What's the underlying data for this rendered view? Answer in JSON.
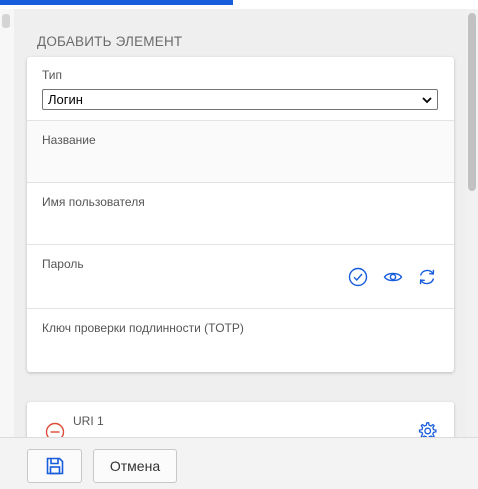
{
  "section_title": "ДОБАВИТЬ ЭЛЕМЕНТ",
  "fields": {
    "type_label": "Тип",
    "type_value": "Логин",
    "name_label": "Название",
    "username_label": "Имя пользователя",
    "password_label": "Пароль",
    "totp_label": "Ключ проверки подлинности (TOTP)"
  },
  "uri": {
    "label": "URI 1"
  },
  "footer": {
    "cancel_label": "Отмена"
  },
  "icons": {
    "check": "check-circle-icon",
    "eye": "eye-icon",
    "generate": "refresh-icon",
    "remove": "minus-circle-icon",
    "settings": "gear-icon",
    "save": "save-icon"
  },
  "colors": {
    "accent": "#175ddc",
    "danger": "#dd4b39",
    "icon_blue": "#175ddc"
  }
}
